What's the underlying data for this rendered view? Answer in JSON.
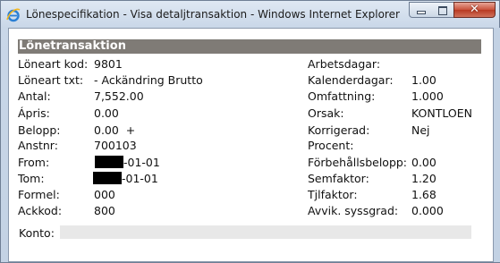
{
  "window": {
    "title": "Lönespecifikation - Visa detaljtransaktion - Windows Internet Explorer",
    "app_icon": "internet-explorer-icon",
    "controls": {
      "minimize_icon": "minimize-icon",
      "maximize_icon": "maximize-icon",
      "close_icon": "close-icon",
      "close_glyph": "✕"
    }
  },
  "section": {
    "title": "Lönetransaktion"
  },
  "left_fields": [
    {
      "label": "Löneart kod:",
      "value": "9801"
    },
    {
      "label": "Löneart txt:",
      "value": "- Ackändring Brutto"
    },
    {
      "label": "Antal:",
      "value": "7,552.00"
    },
    {
      "label": "Ápris:",
      "value": "0.00"
    },
    {
      "label": "Belopp:",
      "value": "0.00  +"
    },
    {
      "label": "Anstnr:",
      "value": "700103"
    },
    {
      "label": "From:",
      "value": "-01-01",
      "redacted_prefix": true
    },
    {
      "label": "Tom:",
      "value": "-01-01",
      "redacted_prefix": true
    },
    {
      "label": "Formel:",
      "value": "000"
    },
    {
      "label": "Ackkod:",
      "value": "800"
    }
  ],
  "right_fields": [
    {
      "label": "Arbetsdagar:",
      "value": ""
    },
    {
      "label": "Kalenderdagar:",
      "value": "1.00"
    },
    {
      "label": "Omfattning:",
      "value": "1.000"
    },
    {
      "label": "Orsak:",
      "value": "KONTLOEN"
    },
    {
      "label": "Korrigerad:",
      "value": "Nej"
    },
    {
      "label": "Procent:",
      "value": ""
    },
    {
      "label": "Förbehållsbelopp:",
      "value": "0.00"
    },
    {
      "label": "Semfaktor:",
      "value": "1.20"
    },
    {
      "label": "Tjlfaktor:",
      "value": "1.68"
    },
    {
      "label": "Avvik. syssgrad:",
      "value": "0.000"
    }
  ],
  "konto": {
    "label": "Konto:",
    "value": ""
  }
}
